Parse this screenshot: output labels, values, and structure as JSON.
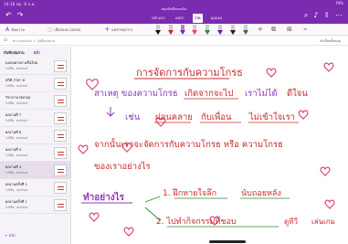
{
  "status": {
    "left": "10:18 พฤ. 8 ธ.ค.",
    "right": "79%"
  },
  "app": {
    "title": "สมุดบันทึกของฉัน"
  },
  "menu_tabs": [
    {
      "label": "หน้าแรก",
      "active": false
    },
    {
      "label": "แทรก",
      "active": false
    },
    {
      "label": "วาด",
      "active": true
    },
    {
      "label": "มุมมอง",
      "active": false
    }
  ],
  "ribbon": {
    "text_mode": "ข้อความ",
    "lasso": "เลือกแบบ Lasso",
    "space": "แทรกช่องว่าง"
  },
  "notebook_bar": {
    "path": "ทำงานของฉัน > บันทึกย่อด่วน",
    "right": "ตัวเลือกทั้งหมด"
  },
  "sidebar": {
    "header": "บันทึกย่อด่วน",
    "tab": "หน้า",
    "pages": [
      {
        "title": "มอบหมายงานชิ้นใหม่",
        "sub": "ไม่มีชื่อ · พลล์เชอร์"
      },
      {
        "title": "สถิติ ภาษา 6",
        "sub": "ไม่มีชื่อ · พลล์เชอร์"
      },
      {
        "title": "วิชาภาษาอังกฤษ",
        "sub": "ไม่มีชื่อ · พลล์เชอร์"
      },
      {
        "title": "ผลงานที่ 7",
        "sub": "ไม่มีชื่อ · พลล์เชอร์"
      },
      {
        "title": "ผลงานที่ 8",
        "sub": "ไม่มีชื่อ · พลล์เชอร์"
      },
      {
        "title": "ผลงานที่ 5",
        "sub": "ไม่มีชื่อ · พลล์เชอร์"
      },
      {
        "title": "ผลงานที่ 4",
        "sub": "ไม่มีชื่อ · พลล์เชอร์",
        "selected": true
      },
      {
        "title": "ผลงานครั้งที่ 2",
        "sub": "ไม่มีชื่อ · พลล์เชอร์"
      },
      {
        "title": "ผลงานครั้งที่ 1",
        "sub": "ไม่มีชื่อ · พลล์เชอร์"
      }
    ],
    "add_page": "+ หน้า"
  },
  "note": {
    "line1": "การจัดการกับความโกรธ",
    "line2a": "สาเหตุ ของความโกรธ",
    "line2b": "เกิดจากจะไป",
    "line2c": "เราไม่ได้",
    "line2d": "ดีใจน",
    "line3a": "เช่น",
    "line3b": "ผ่อนคลาย",
    "line3c": "กับเพื่อน",
    "line3d": "ไม่เข้าใจเรา",
    "line4": "จากนั้นเราจะจัดการกับความโกรธ หรือ ความโกรธ",
    "line5": "ของเราอย่างไร",
    "line6a": "ทำอย่างไร",
    "line6b": "1. ฝึกหายใจลึก",
    "line6c": "นับถอยหลัง",
    "line7a": "2. ไปทำกิจกรรมที่ชอบ",
    "line7b": "ดูทีวี",
    "line7c": "เล่นเกม",
    "colors": {
      "accent": "#7a2bb0",
      "ink_red": "#c62b2b",
      "ink_purple": "#8a3bb5",
      "ink_green": "#2e8b2e",
      "heart_pink": "#e0457a"
    }
  }
}
